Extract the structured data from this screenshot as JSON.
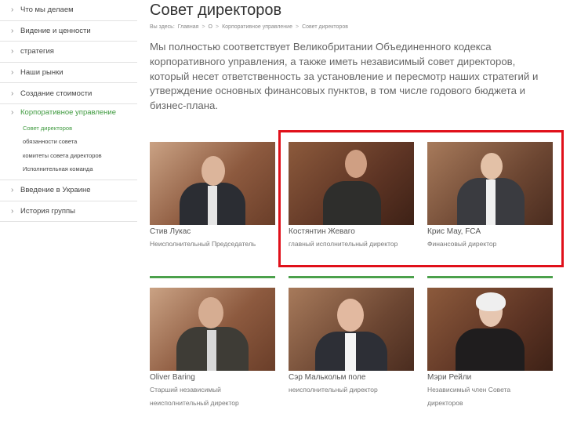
{
  "sidebar": {
    "items": [
      {
        "label": "Что мы делаем"
      },
      {
        "label": "Видение и ценности"
      },
      {
        "label": "стратегия"
      },
      {
        "label": "Наши рынки"
      },
      {
        "label": "Создание стоимости"
      },
      {
        "label": "Корпоративное управление",
        "active": true
      },
      {
        "label": "Введение в Украине"
      },
      {
        "label": "История группы"
      }
    ],
    "sub_items": [
      {
        "label": "Совет директоров",
        "active": true
      },
      {
        "label": "обязанности совета"
      },
      {
        "label": "комитеты совета директоров"
      },
      {
        "label": "Исполнительная команда"
      }
    ]
  },
  "page": {
    "title": "Совет директоров",
    "breadcrumb": {
      "prefix": "Вы здесь:",
      "items": [
        "Главная",
        "О",
        "Корпоративное управление",
        "Совет директоров"
      ]
    },
    "intro": "Мы полностью соответствует Великобритании Объединенного кодекса корпоративного управления, а также иметь независимый совет директоров, который несет ответственность за установление и пересмотр наших стратегий и утверждение основных финансовых пунктов, в том числе годового бюджета и бизнес-плана."
  },
  "directors": [
    {
      "name": "Стив Лукас",
      "role": "Неисполнительный Председатель"
    },
    {
      "name": "Костянтин Жеваго",
      "role": "главный исполнительный директор"
    },
    {
      "name": "Крис Мау, FCA",
      "role": "Финансовый директор"
    },
    {
      "name": "Oliver Baring",
      "role": "Старший независимый неисполнительный директор"
    },
    {
      "name": "Сэр Малькольм поле",
      "role": "неисполнительный директор"
    },
    {
      "name": "Мэри Рейли",
      "role": "Независимый член Совета директоров"
    }
  ],
  "colors": {
    "accent": "#4ca14c",
    "highlight": "#e0101a"
  }
}
